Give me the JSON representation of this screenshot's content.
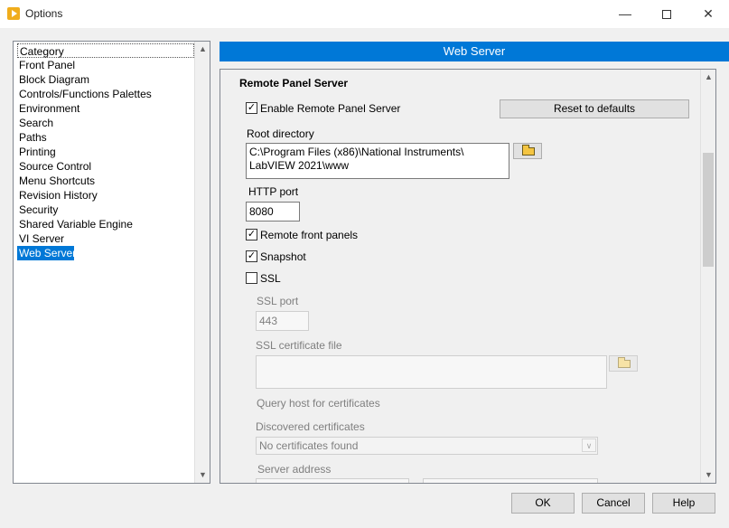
{
  "window": {
    "title": "Options",
    "minimize_glyph": "—",
    "close_glyph": "✕"
  },
  "category": {
    "header": "Category",
    "items": [
      "Front Panel",
      "Block Diagram",
      "Controls/Functions Palettes",
      "Environment",
      "Search",
      "Paths",
      "Printing",
      "Source Control",
      "Menu Shortcuts",
      "Revision History",
      "Security",
      "Shared Variable Engine",
      "VI Server",
      "Web Server"
    ],
    "selected": "Web Server"
  },
  "panel": {
    "title": "Web Server",
    "section_title": "Remote Panel Server",
    "enable_remote_panel_server": {
      "label": "Enable Remote Panel Server",
      "checked": true
    },
    "reset_button": "Reset to defaults",
    "root_directory": {
      "label": "Root directory",
      "line1": "C:\\Program Files (x86)\\National Instruments\\",
      "line2": "LabVIEW 2021\\www"
    },
    "http_port": {
      "label": "HTTP port",
      "value": "8080"
    },
    "remote_front_panels": {
      "label": "Remote front panels",
      "checked": true
    },
    "snapshot": {
      "label": "Snapshot",
      "checked": true
    },
    "ssl": {
      "label": "SSL",
      "checked": false
    },
    "ssl_port": {
      "label": "SSL port",
      "value": "443"
    },
    "ssl_certificate_file": {
      "label": "SSL certificate file",
      "value": ""
    },
    "query_host": "Query host for certificates",
    "discovered_certificates": {
      "label": "Discovered certificates",
      "value": "No certificates found"
    },
    "server_address": "Server address",
    "check_glyph": "✓",
    "scroll_up_glyph": "▲",
    "scroll_down_glyph": "▼",
    "dropdown_glyph": "∨"
  },
  "buttons": {
    "ok": "OK",
    "cancel": "Cancel",
    "help": "Help"
  },
  "icons": {
    "app": "labview-icon",
    "folder": "folder-open-icon"
  }
}
